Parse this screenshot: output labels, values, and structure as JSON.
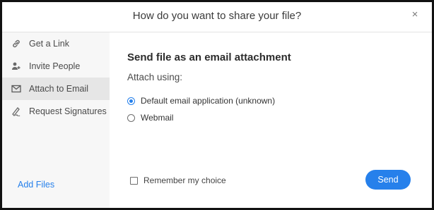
{
  "dialog": {
    "title": "How do you want to share your file?",
    "close_glyph": "×"
  },
  "sidebar": {
    "items": [
      {
        "label": "Get a Link",
        "icon": "link-icon",
        "active": false
      },
      {
        "label": "Invite People",
        "icon": "invite-people-icon",
        "active": false
      },
      {
        "label": "Attach to Email",
        "icon": "email-icon",
        "active": true
      },
      {
        "label": "Request Signatures",
        "icon": "signature-icon",
        "active": false
      }
    ],
    "add_files": "Add Files"
  },
  "main": {
    "heading": "Send file as an email attachment",
    "attach_label": "Attach using:",
    "options": [
      {
        "label": "Default email application (unknown)",
        "selected": true
      },
      {
        "label": "Webmail",
        "selected": false
      }
    ],
    "remember_label": "Remember my choice",
    "remember_checked": false,
    "send_label": "Send"
  },
  "colors": {
    "accent": "#2680eb",
    "sidebar_bg": "#f7f7f7",
    "active_item_bg": "#e6e6e6"
  }
}
